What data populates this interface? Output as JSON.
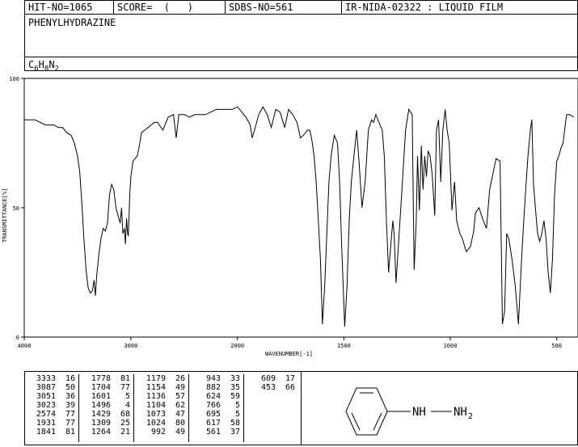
{
  "header": {
    "hit_no": "HIT-NO=1065",
    "score": "SCORE=  (   )",
    "sdbs_no": "SDBS-NO=561",
    "method": "IR-NIDA-02322 : LIQUID FILM"
  },
  "compound": {
    "name": "PHENYLHYDRAZINE",
    "formula_parts": [
      "C",
      "6",
      "H",
      "8",
      "N",
      "2"
    ]
  },
  "chart_data": {
    "type": "line",
    "xlabel": "WAVENUMBER[-1]",
    "ylabel": "TRANSMITTANCE[%]",
    "xlim": [
      4000,
      400
    ],
    "ylim": [
      0,
      100
    ],
    "x_ticks": [
      4000,
      3000,
      2000,
      1500,
      1000,
      500
    ],
    "y_ticks": [
      0,
      50,
      100
    ],
    "x": [
      4000,
      3900,
      3800,
      3760,
      3720,
      3680,
      3640,
      3600,
      3560,
      3530,
      3500,
      3480,
      3460,
      3440,
      3420,
      3400,
      3380,
      3360,
      3345,
      3333,
      3320,
      3300,
      3280,
      3260,
      3240,
      3220,
      3200,
      3180,
      3160,
      3140,
      3120,
      3100,
      3087,
      3075,
      3060,
      3051,
      3040,
      3030,
      3023,
      3010,
      3000,
      2980,
      2960,
      2940,
      2920,
      2900,
      2870,
      2840,
      2810,
      2780,
      2750,
      2700,
      2650,
      2600,
      2574,
      2550,
      2500,
      2450,
      2400,
      2300,
      2200,
      2100,
      2050,
      2000,
      1980,
      1960,
      1940,
      1931,
      1920,
      1900,
      1880,
      1860,
      1841,
      1820,
      1800,
      1778,
      1760,
      1740,
      1720,
      1704,
      1690,
      1680,
      1670,
      1660,
      1650,
      1640,
      1630,
      1620,
      1610,
      1601,
      1590,
      1580,
      1570,
      1560,
      1545,
      1530,
      1520,
      1510,
      1496,
      1485,
      1475,
      1465,
      1450,
      1440,
      1429,
      1415,
      1400,
      1385,
      1370,
      1360,
      1350,
      1340,
      1330,
      1320,
      1310,
      1300,
      1290,
      1280,
      1270,
      1264,
      1255,
      1240,
      1225,
      1210,
      1195,
      1179,
      1170,
      1160,
      1154,
      1145,
      1136,
      1128,
      1120,
      1112,
      1104,
      1095,
      1085,
      1073,
      1065,
      1055,
      1045,
      1035,
      1024,
      1015,
      1005,
      992,
      980,
      970,
      955,
      943,
      925,
      905,
      890,
      882,
      865,
      845,
      830,
      815,
      800,
      785,
      766,
      755,
      745,
      735,
      725,
      710,
      695,
      680,
      665,
      655,
      645,
      635,
      624,
      617,
      609,
      600,
      590,
      580,
      570,
      560,
      550,
      540,
      530,
      520,
      510,
      500,
      490,
      480,
      470,
      460,
      453,
      440,
      420,
      400
    ],
    "y": [
      84,
      84,
      82,
      82,
      82,
      81,
      81,
      79,
      78,
      75,
      70,
      64,
      52,
      38,
      26,
      19,
      17,
      18,
      22,
      16,
      24,
      32,
      38,
      42,
      41,
      44,
      55,
      59,
      57,
      50,
      47,
      44,
      50,
      40,
      42,
      36,
      46,
      40,
      39,
      55,
      62,
      68,
      69,
      70,
      74,
      79,
      80,
      81,
      82,
      83,
      83,
      80,
      85,
      86,
      77,
      86,
      86,
      85,
      86,
      86,
      88,
      88,
      88,
      89,
      87,
      85,
      82,
      77,
      80,
      86,
      89,
      86,
      81,
      88,
      87,
      81,
      88,
      86,
      83,
      77,
      78,
      79,
      80,
      80,
      76,
      70,
      60,
      45,
      30,
      5,
      20,
      40,
      60,
      70,
      78,
      75,
      60,
      35,
      4,
      20,
      45,
      60,
      72,
      80,
      68,
      50,
      60,
      80,
      84,
      83,
      86,
      84,
      82,
      80,
      70,
      45,
      25,
      35,
      45,
      40,
      21,
      40,
      60,
      80,
      88,
      86,
      26,
      45,
      70,
      49,
      74,
      57,
      70,
      62,
      72,
      70,
      63,
      47,
      80,
      84,
      60,
      80,
      88,
      80,
      75,
      49,
      60,
      45,
      40,
      38,
      33,
      35,
      41,
      48,
      50,
      45,
      42,
      57,
      63,
      69,
      68,
      5,
      10,
      40,
      38,
      30,
      20,
      5,
      30,
      45,
      58,
      70,
      80,
      84,
      59,
      50,
      40,
      37,
      40,
      45,
      38,
      25,
      17,
      30,
      55,
      68,
      70,
      73,
      75,
      82,
      86,
      86,
      85
    ],
    "peaks": [
      [
        "3333",
        "16"
      ],
      [
        "3087",
        "50"
      ],
      [
        "3051",
        "36"
      ],
      [
        "3023",
        "39"
      ],
      [
        "2574",
        "77"
      ],
      [
        "1931",
        "77"
      ],
      [
        "1841",
        "81"
      ],
      [
        "1778",
        "81"
      ],
      [
        "1704",
        "77"
      ],
      [
        "1601",
        "5"
      ],
      [
        "1496",
        "4"
      ],
      [
        "1429",
        "68"
      ],
      [
        "1309",
        "25"
      ],
      [
        "1264",
        "21"
      ],
      [
        "1179",
        "26"
      ],
      [
        "1154",
        "49"
      ],
      [
        "1136",
        "57"
      ],
      [
        "1104",
        "62"
      ],
      [
        "1073",
        "47"
      ],
      [
        "1024",
        "80"
      ],
      [
        "992",
        "49"
      ],
      [
        "943",
        "33"
      ],
      [
        "882",
        "35"
      ],
      [
        "624",
        "59"
      ],
      [
        "766",
        "5"
      ],
      [
        "695",
        "5"
      ],
      [
        "617",
        "58"
      ],
      [
        "561",
        "37"
      ],
      [
        "609",
        "17"
      ],
      [
        "453",
        "66"
      ]
    ]
  },
  "structure": {
    "nh_label": "NH",
    "nh2_label": "NH",
    "nh2_sub": "2"
  }
}
